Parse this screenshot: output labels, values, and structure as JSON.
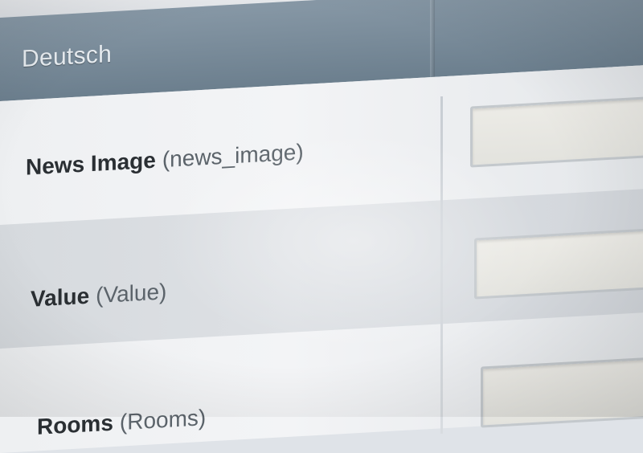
{
  "section": {
    "title": "Deutsch"
  },
  "fields": [
    {
      "label": "News Image",
      "key": "(news_image)",
      "value": ""
    },
    {
      "label": "Value",
      "key": "(Value)",
      "value": ""
    },
    {
      "label": "Rooms",
      "key": "(Rooms)",
      "value": ""
    }
  ]
}
